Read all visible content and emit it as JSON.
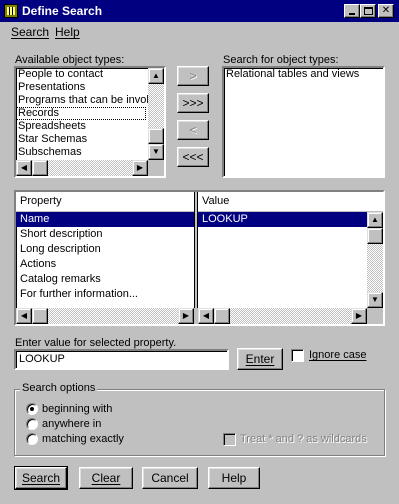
{
  "window": {
    "title": "Define Search",
    "minimize_icon": "minimize-icon",
    "maximize_icon": "maximize-icon",
    "close_icon": "close-icon"
  },
  "menubar": {
    "items": [
      {
        "label": "Search",
        "mnemonic": "S"
      },
      {
        "label": "Help",
        "mnemonic": "H"
      }
    ]
  },
  "available": {
    "label": "Available object types:",
    "items": [
      "People to contact",
      "Presentations",
      "Programs that can be invok",
      "Records",
      "Spreadsheets",
      "Star Schemas",
      "Subschemas"
    ],
    "focused_index": 3
  },
  "transfer_buttons": {
    "add": ">",
    "add_all": ">>>",
    "remove": "<",
    "remove_all": "<<<"
  },
  "search_for": {
    "label": "Search for object types:",
    "items": [
      "Relational tables and views"
    ]
  },
  "properties": {
    "col_property": "Property",
    "col_value": "Value",
    "rows": [
      {
        "property": "Name",
        "value": "LOOKUP",
        "selected": true
      },
      {
        "property": "Short description",
        "value": ""
      },
      {
        "property": "Long description",
        "value": ""
      },
      {
        "property": "Actions",
        "value": ""
      },
      {
        "property": "Catalog remarks",
        "value": ""
      },
      {
        "property": "For further information...",
        "value": ""
      }
    ]
  },
  "value_entry": {
    "label": "Enter value for selected property.",
    "value": "LOOKUP",
    "enter_button": "Enter",
    "ignore_case": "Ignore case",
    "ignore_case_checked": false
  },
  "search_options": {
    "title": "Search options",
    "options": [
      {
        "label": "beginning with",
        "selected": true
      },
      {
        "label": "anywhere in",
        "selected": false
      },
      {
        "label": "matching exactly",
        "selected": false
      }
    ],
    "wildcards_label": "Treat * and ? as wildcards",
    "wildcards_checked": false
  },
  "footer_buttons": {
    "search": "Search",
    "clear": "Clear",
    "cancel": "Cancel",
    "help": "Help"
  }
}
